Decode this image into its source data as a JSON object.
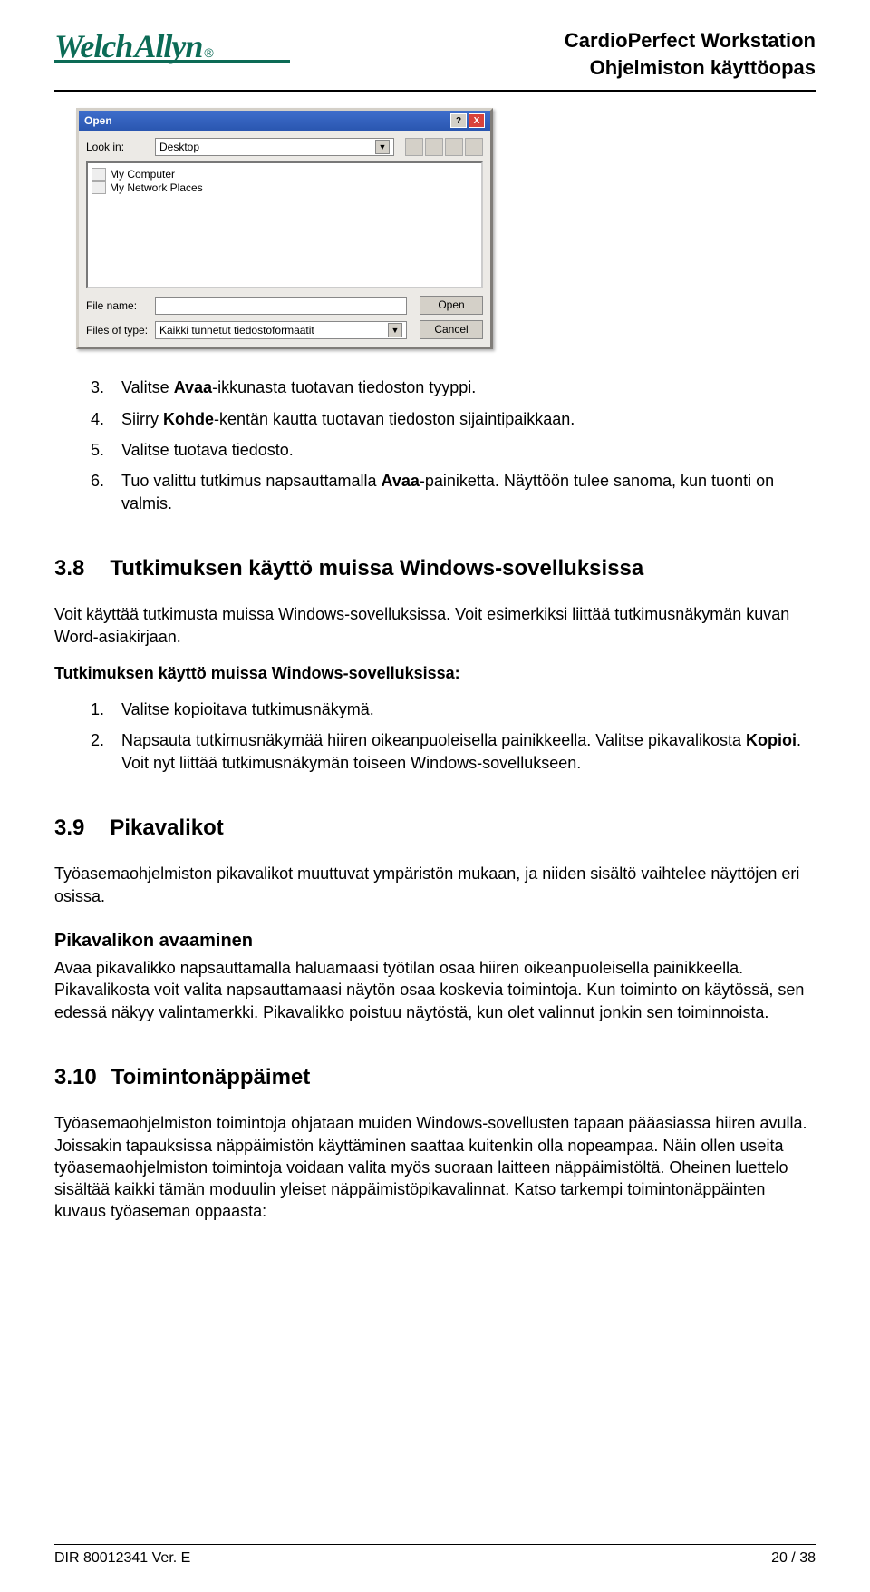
{
  "header": {
    "logo_left": "Welch",
    "logo_right": "Allyn",
    "title1": "CardioPerfect Workstation",
    "title2": "Ohjelmiston käyttöopas"
  },
  "dialog": {
    "title": "Open",
    "help": "?",
    "close": "X",
    "lookin_label": "Look in:",
    "lookin_value": "Desktop",
    "items": [
      "My Computer",
      "My Network Places"
    ],
    "filename_label": "File name:",
    "filename_value": "",
    "filetype_label": "Files of type:",
    "filetype_value": "Kaikki tunnetut tiedostoformaatit",
    "open_btn": "Open",
    "cancel_btn": "Cancel"
  },
  "steps_a": [
    {
      "n": "3.",
      "t": "Valitse ",
      "b": "Avaa",
      "r": "-ikkunasta tuotavan tiedoston tyyppi."
    },
    {
      "n": "4.",
      "t": "Siirry ",
      "b": "Kohde",
      "r": "-kentän kautta tuotavan tiedoston sijaintipaikkaan."
    },
    {
      "n": "5.",
      "t": "Valitse tuotava tiedosto.",
      "b": "",
      "r": ""
    },
    {
      "n": "6.",
      "t": "Tuo valittu tutkimus napsauttamalla ",
      "b": "Avaa",
      "r": "-painiketta. Näyttöön tulee sanoma, kun tuonti on valmis."
    }
  ],
  "sec38": {
    "num": "3.8",
    "title": "Tutkimuksen käyttö muissa Windows-sovelluksissa",
    "p1": "Voit käyttää tutkimusta muissa Windows-sovelluksissa. Voit esimerkiksi liittää tutkimusnäkymän kuvan Word-asiakirjaan.",
    "sub": "Tutkimuksen käyttö muissa Windows-sovelluksissa:",
    "steps": [
      {
        "n": "1.",
        "t": "Valitse kopioitava tutkimusnäkymä."
      },
      {
        "n": "2.",
        "t1": "Napsauta tutkimusnäkymää hiiren oikeanpuoleisella painikkeella. Valitse pikavalikosta ",
        "b": "Kopioi",
        "t2": ". Voit nyt liittää tutkimusnäkymän toiseen Windows-sovellukseen."
      }
    ]
  },
  "sec39": {
    "num": "3.9",
    "title": "Pikavalikot",
    "p1": "Työasemaohjelmiston pikavalikot muuttuvat ympäristön mukaan, ja niiden sisältö vaihtelee näyttöjen eri osissa.",
    "sub": "Pikavalikon avaaminen",
    "p2": "Avaa pikavalikko napsauttamalla haluamaasi työtilan osaa hiiren oikeanpuoleisella painikkeella. Pikavalikosta voit valita napsauttamaasi näytön osaa koskevia toimintoja. Kun toiminto on käytössä, sen edessä näkyy valintamerkki. Pikavalikko poistuu näytöstä, kun olet valinnut jonkin sen toiminnoista."
  },
  "sec310": {
    "num": "3.10",
    "title": "Toimintonäppäimet",
    "p1": "Työasemaohjelmiston toimintoja ohjataan muiden Windows-sovellusten tapaan pääasiassa hiiren avulla. Joissakin tapauksissa näppäimistön käyttäminen saattaa kuitenkin olla nopeampaa. Näin ollen useita työasemaohjelmiston toimintoja voidaan valita myös suoraan laitteen näppäimistöltä. Oheinen luettelo sisältää kaikki tämän moduulin yleiset näppäimistöpikavalinnat. Katso tarkempi toimintonäppäinten kuvaus työaseman oppaasta:"
  },
  "footer": {
    "left": "DIR 80012341 Ver. E",
    "right": "20 / 38"
  }
}
